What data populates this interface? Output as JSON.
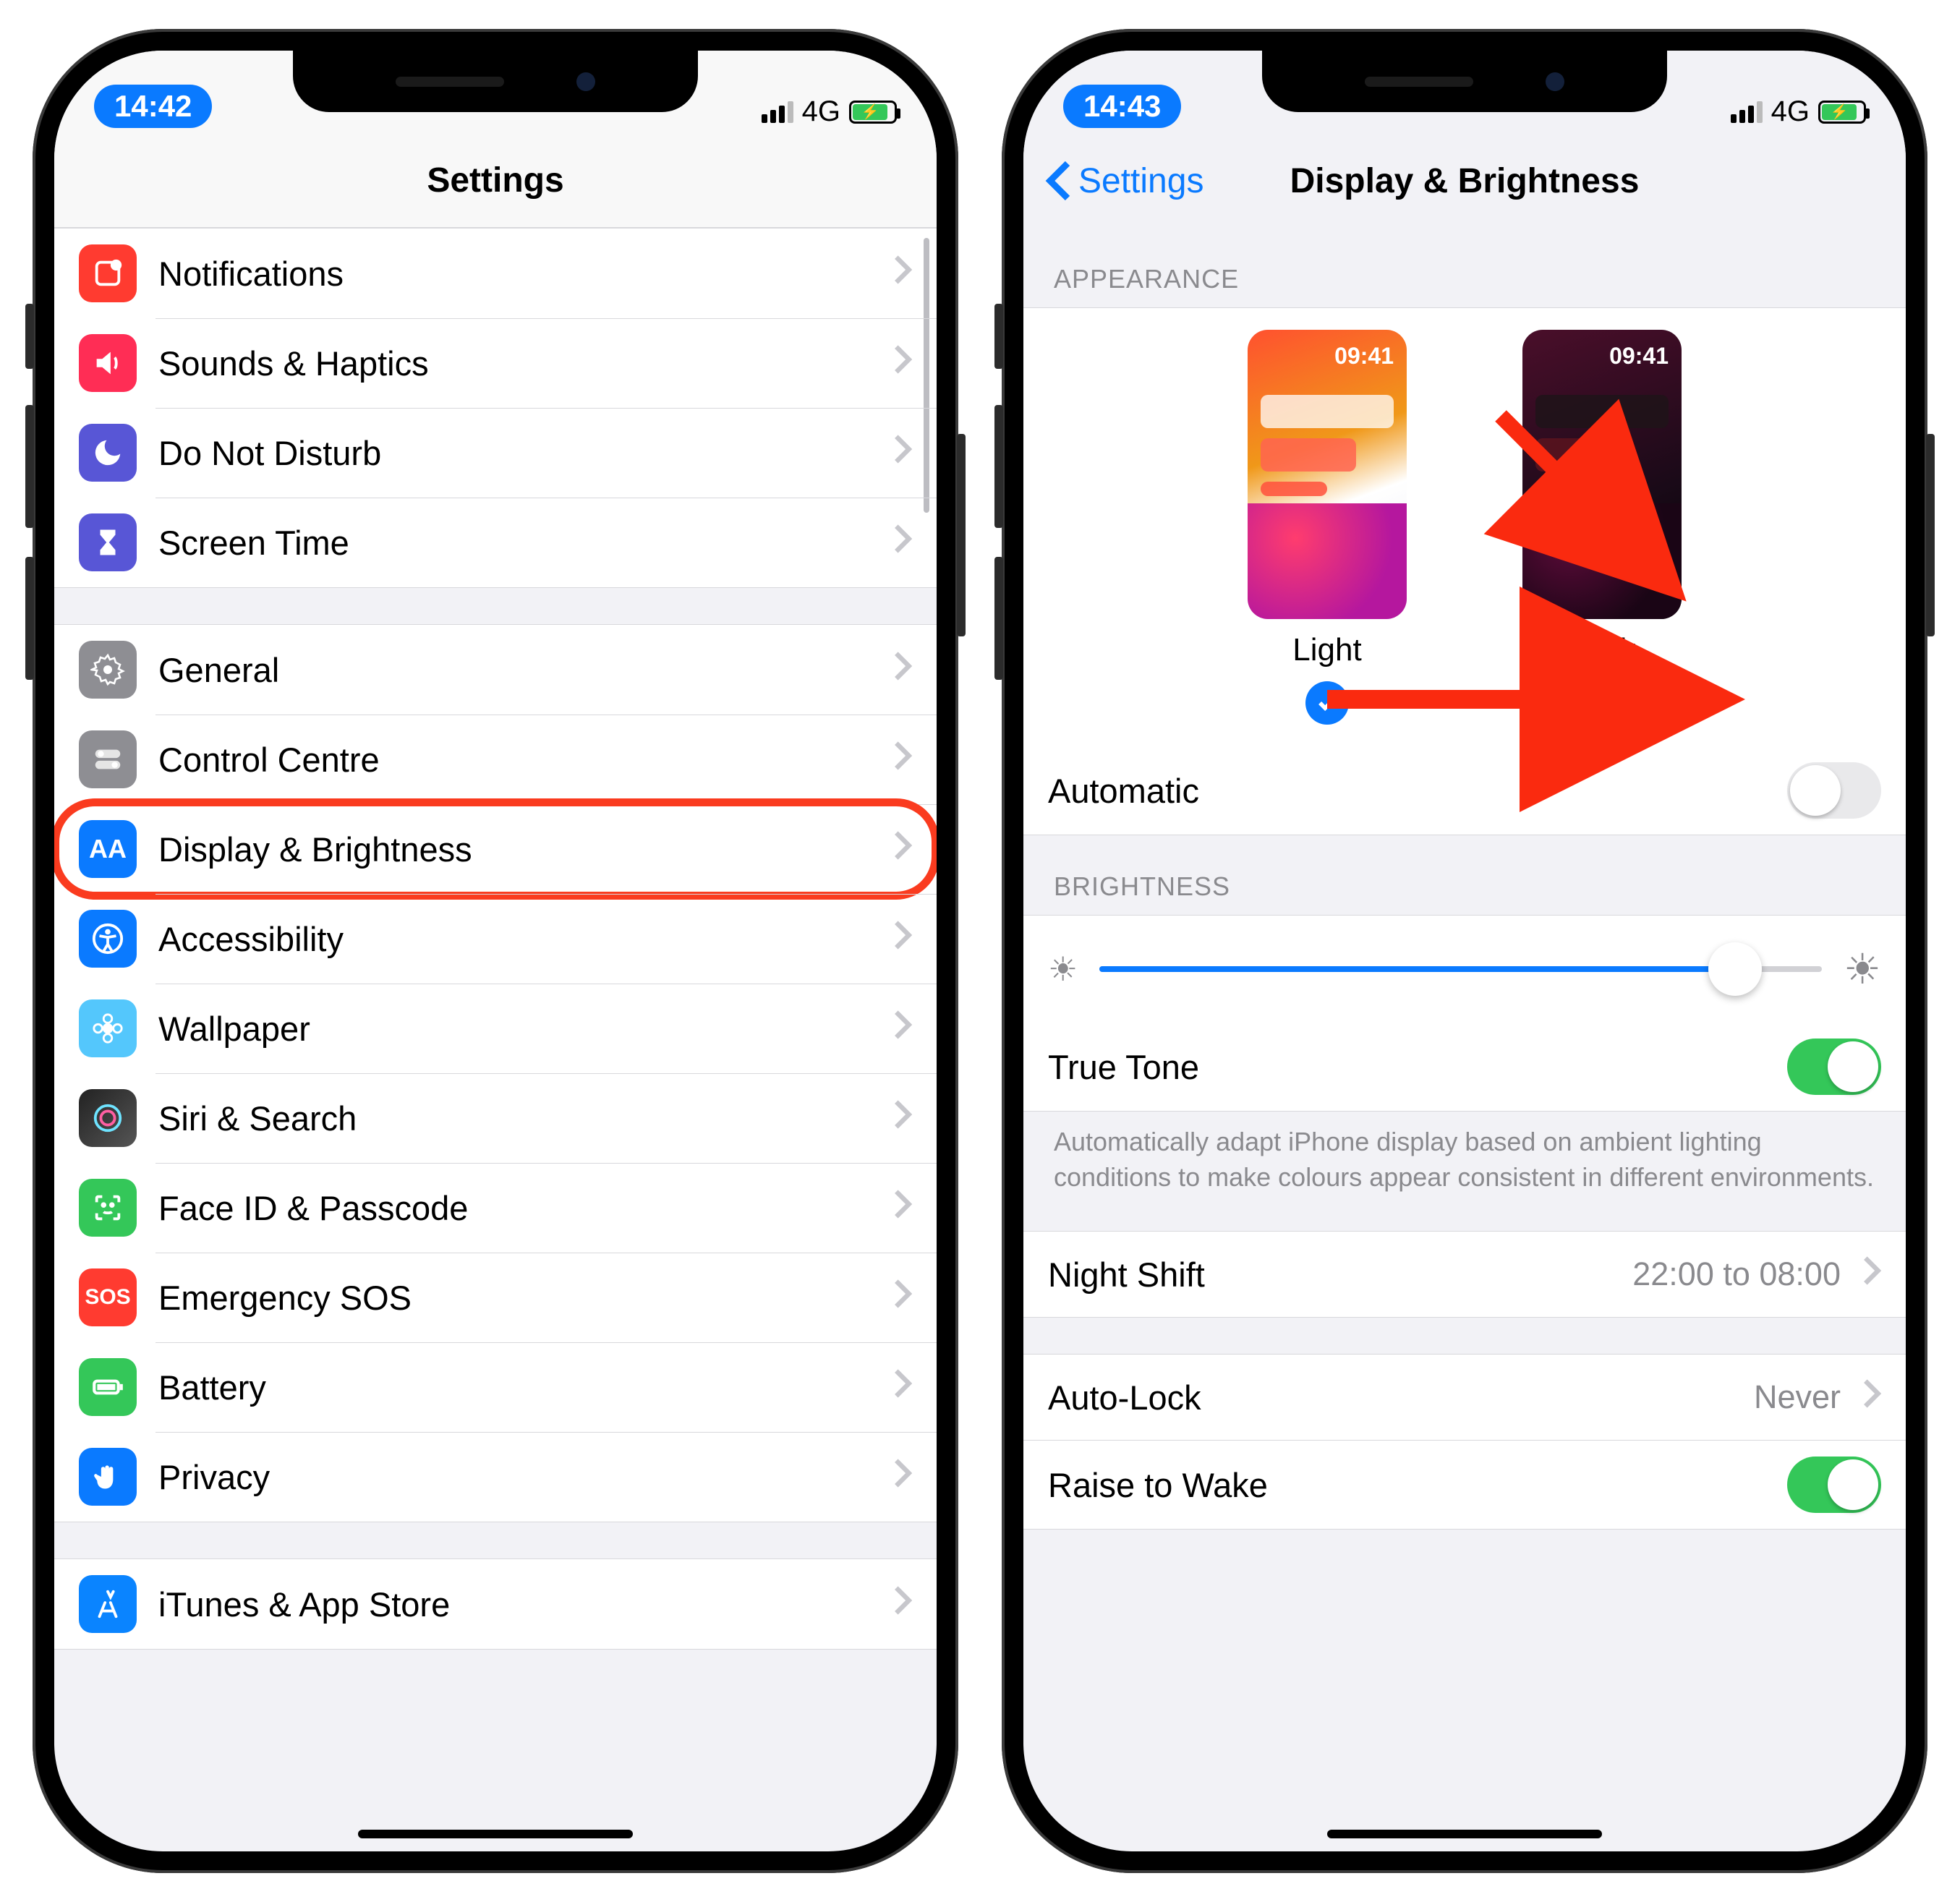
{
  "left": {
    "status_time": "14:42",
    "net": "4G",
    "title": "Settings",
    "groups": [
      {
        "items": [
          {
            "id": "notifications",
            "label": "Notifications"
          },
          {
            "id": "sounds",
            "label": "Sounds & Haptics"
          },
          {
            "id": "dnd",
            "label": "Do Not Disturb"
          },
          {
            "id": "screentime",
            "label": "Screen Time"
          }
        ]
      },
      {
        "items": [
          {
            "id": "general",
            "label": "General"
          },
          {
            "id": "controlcentre",
            "label": "Control Centre"
          },
          {
            "id": "display",
            "label": "Display & Brightness",
            "highlighted": true
          },
          {
            "id": "accessibility",
            "label": "Accessibility"
          },
          {
            "id": "wallpaper",
            "label": "Wallpaper"
          },
          {
            "id": "siri",
            "label": "Siri & Search"
          },
          {
            "id": "faceid",
            "label": "Face ID & Passcode"
          },
          {
            "id": "sos",
            "label": "Emergency SOS"
          },
          {
            "id": "battery",
            "label": "Battery"
          },
          {
            "id": "privacy",
            "label": "Privacy"
          }
        ]
      },
      {
        "items": [
          {
            "id": "appstore",
            "label": "iTunes & App Store"
          }
        ]
      }
    ]
  },
  "right": {
    "status_time": "14:43",
    "net": "4G",
    "back_label": "Settings",
    "title": "Display & Brightness",
    "appearance_header": "APPEARANCE",
    "thumb_time": "09:41",
    "light_label": "Light",
    "dark_label": "Dark",
    "selected_appearance": "light",
    "automatic_label": "Automatic",
    "automatic_on": false,
    "brightness_header": "BRIGHTNESS",
    "brightness_value": 0.88,
    "truetone_label": "True Tone",
    "truetone_on": true,
    "truetone_footer": "Automatically adapt iPhone display based on ambient lighting conditions to make colours appear consistent in different environments.",
    "nightshift_label": "Night Shift",
    "nightshift_value": "22:00 to 08:00",
    "autolock_label": "Auto-Lock",
    "autolock_value": "Never",
    "raisetowake_label": "Raise to Wake",
    "raisetowake_on": true
  }
}
